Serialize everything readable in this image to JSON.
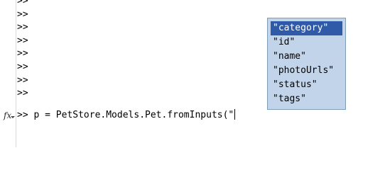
{
  "console": {
    "prompt": ">>",
    "empty_prompts": [
      ">>",
      ">>",
      ">>",
      ">>",
      ">>",
      ">>",
      ">>",
      ">>"
    ],
    "command_prompt": ">>",
    "command_text": "p = PetStore.Models.Pet.fromInputs(\""
  },
  "gutter": {
    "function_icon": "fx-icon",
    "function_icon_glyph": "fx"
  },
  "completion": {
    "items": [
      "\"category\"",
      "\"id\"",
      "\"name\"",
      "\"photoUrls\"",
      "\"status\"",
      "\"tags\""
    ],
    "selected_index": 0
  },
  "colors": {
    "popup_background": "#c2d4ea",
    "popup_border": "#7f9db9",
    "selection_background": "#2f5aa8",
    "selection_text": "#ffffff"
  }
}
